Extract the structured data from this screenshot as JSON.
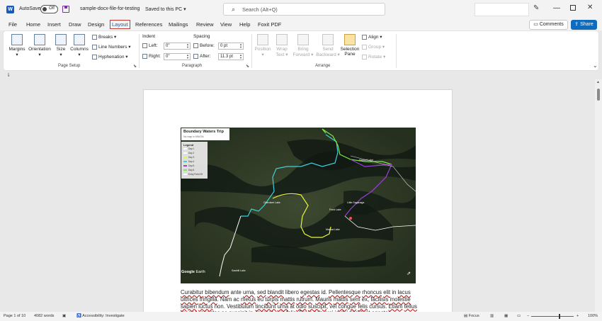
{
  "titlebar": {
    "app_logo": "W",
    "autosave_label": "AutoSave",
    "autosave_state": "Off",
    "document_title": "sample-docx-file-for-testing",
    "save_status": "Saved to this PC",
    "search_placeholder": "Search (Alt+Q)"
  },
  "menu": {
    "tabs": [
      "File",
      "Home",
      "Insert",
      "Draw",
      "Design",
      "Layout",
      "References",
      "Mailings",
      "Review",
      "View",
      "Help",
      "Foxit PDF"
    ],
    "active_tab": "Layout",
    "comments_label": "Comments",
    "share_label": "Share"
  },
  "ribbon": {
    "page_setup": {
      "label": "Page Setup",
      "margins": "Margins",
      "orientation": "Orientation",
      "size": "Size",
      "columns": "Columns",
      "breaks": "Breaks",
      "line_numbers": "Line Numbers",
      "hyphenation": "Hyphenation"
    },
    "paragraph": {
      "label": "Paragraph",
      "indent_label": "Indent",
      "spacing_label": "Spacing",
      "left_label": "Left:",
      "left_value": "0\"",
      "right_label": "Right:",
      "right_value": "0\"",
      "before_label": "Before:",
      "before_value": "0 pt",
      "after_label": "After:",
      "after_value": "11.3 pt"
    },
    "arrange": {
      "label": "Arrange",
      "position": "Position",
      "wrap_text": "Wrap Text",
      "bring_forward": "Bring Forward",
      "send_backward": "Send Backward",
      "selection_pane": "Selection Pane",
      "align": "Align",
      "group": "Group",
      "rotate": "Rotate"
    }
  },
  "document": {
    "map": {
      "title": "Boundary Waters Trip",
      "subtitle": "No map in MN/ON",
      "legend_title": "Legend",
      "legend_items": [
        {
          "label": "Day 1",
          "color": "#ffffff"
        },
        {
          "label": "Day 2",
          "color": "#ffffff"
        },
        {
          "label": "Day 3",
          "color": "#e8f542"
        },
        {
          "label": "Day 4",
          "color": "#3fd0d9"
        },
        {
          "label": "Day 5",
          "color": "#9b3fd9"
        },
        {
          "label": "Day 6",
          "color": "#7ee84a"
        },
        {
          "label": "Entry Point 25",
          "color": "#ffffff"
        }
      ],
      "brand_bold": "Google",
      "brand_rest": " Earth",
      "place_labels": [
        "Hassell Lake",
        "Cherokee Lake",
        "Frost Lake",
        "Little Saganaga",
        "Makwa Lake",
        "Sawbill Lake"
      ]
    },
    "body_words": [
      {
        "t": "Curabitur",
        "s": true
      },
      {
        "t": " ",
        "s": false
      },
      {
        "t": "bibendum",
        "s": true
      },
      {
        "t": " ante ",
        "s": false
      },
      {
        "t": "urna",
        "s": true
      },
      {
        "t": ", ",
        "s": false
      },
      {
        "t": "sed",
        "s": true
      },
      {
        "t": " ",
        "s": false
      },
      {
        "t": "blandit",
        "s": true
      },
      {
        "t": " libero ",
        "s": false
      },
      {
        "t": "egestas",
        "s": true
      },
      {
        "t": " id. ",
        "s": false
      },
      {
        "t": "Pellentesque",
        "s": true
      },
      {
        "t": " ",
        "s": false
      },
      {
        "t": "rhoncus",
        "s": true
      },
      {
        "t": " ",
        "s": false
      },
      {
        "t": "elit",
        "s": true
      },
      {
        "t": " in ",
        "s": false
      },
      {
        "t": "lacus",
        "s": true
      },
      {
        "t": " ",
        "s": false
      },
      {
        "t": "ultrices",
        "s": true
      },
      {
        "t": " ",
        "s": false
      },
      {
        "t": "fringilla",
        "s": true
      },
      {
        "t": ". Nam ac ",
        "s": false
      },
      {
        "t": "metus",
        "s": true
      },
      {
        "t": " eu ",
        "s": false
      },
      {
        "t": "turpis",
        "s": true
      },
      {
        "t": " ",
        "s": false
      },
      {
        "t": "mattis",
        "s": true
      },
      {
        "t": " ",
        "s": false
      },
      {
        "t": "rutrum",
        "s": true
      },
      {
        "t": ". ",
        "s": false
      },
      {
        "t": "Mauris",
        "s": true
      },
      {
        "t": " ",
        "s": false
      },
      {
        "t": "mattis",
        "s": true
      },
      {
        "t": " ",
        "s": false
      },
      {
        "t": "sem",
        "s": true
      },
      {
        "t": " ex, ",
        "s": false
      },
      {
        "t": "facilisis",
        "s": true
      },
      {
        "t": " ",
        "s": false
      },
      {
        "t": "molestie",
        "s": true
      },
      {
        "t": " ",
        "s": false
      },
      {
        "t": "sapien",
        "s": true
      },
      {
        "t": " ",
        "s": false
      },
      {
        "t": "luctus",
        "s": true
      },
      {
        "t": " non. Vestibulum ",
        "s": false
      },
      {
        "t": "tincidunt",
        "s": true
      },
      {
        "t": " ",
        "s": false
      },
      {
        "t": "urna",
        "s": true
      },
      {
        "t": " at ",
        "s": false
      },
      {
        "t": "odio",
        "s": true
      },
      {
        "t": " ",
        "s": false
      },
      {
        "t": "suscipit",
        "s": true
      },
      {
        "t": ", vel ",
        "s": false
      },
      {
        "t": "congue",
        "s": true
      },
      {
        "t": " ",
        "s": false
      },
      {
        "t": "felis",
        "s": true
      },
      {
        "t": " cursus. ",
        "s": false
      },
      {
        "t": "Etiam",
        "s": true
      },
      {
        "t": " ",
        "s": false
      },
      {
        "t": "tellus",
        "s": true
      },
      {
        "t": " ",
        "s": false
      },
      {
        "t": "magna",
        "s": true
      },
      {
        "t": ", ",
        "s": false
      },
      {
        "t": "egestas",
        "s": true
      },
      {
        "t": " ac ",
        "s": false
      },
      {
        "t": "suscipit",
        "s": true
      },
      {
        "t": " in, ",
        "s": false
      },
      {
        "t": "laoreet",
        "s": true
      },
      {
        "t": " ",
        "s": false
      },
      {
        "t": "quis",
        "s": true
      },
      {
        "t": " ",
        "s": false
      },
      {
        "t": "felis",
        "s": true
      },
      {
        "t": ". Proin non ",
        "s": false
      },
      {
        "t": "orci",
        "s": true
      },
      {
        "t": " id dui ",
        "s": false
      },
      {
        "t": "tincidunt",
        "s": true
      },
      {
        "t": " ",
        "s": false
      },
      {
        "t": "egestas",
        "s": true
      },
      {
        "t": ".",
        "s": false
      }
    ]
  },
  "statusbar": {
    "page": "Page 1 of 10",
    "words": "4082 words",
    "accessibility": "Accessibility: Investigate",
    "focus": "Focus",
    "zoom": "100%",
    "zoom_minus": "−",
    "zoom_plus": "+"
  },
  "icons": [
    "word-icon",
    "save-icon",
    "search-icon",
    "pen-icon",
    "minimize-icon",
    "maximize-icon",
    "close-icon",
    "comment-icon",
    "share-icon",
    "chevron-up-icon",
    "proofing-icon",
    "accessibility-icon",
    "focus-icon"
  ]
}
